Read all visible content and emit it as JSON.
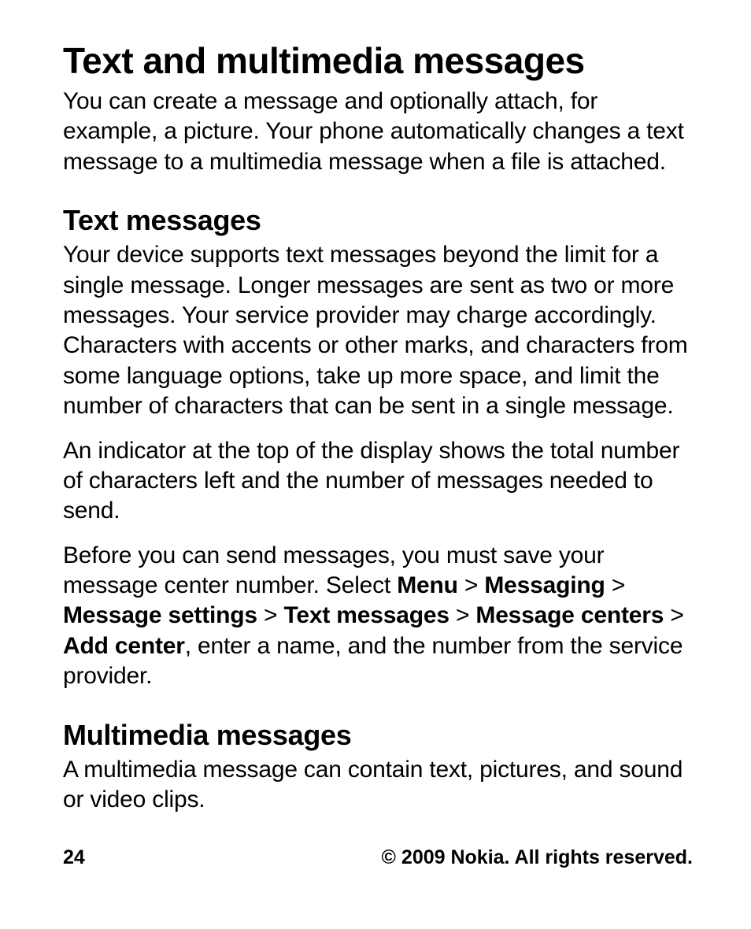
{
  "title": "Text and multimedia messages",
  "intro": "You can create a message and optionally attach, for example, a picture. Your phone automatically changes a text message to a multimedia message when a file is attached.",
  "section_text": {
    "heading": "Text messages",
    "p1": "Your device supports text messages beyond the limit for a single message. Longer messages are sent as two or more messages. Your service provider may charge accordingly. Characters with accents or other marks, and characters from some language options, take up more space, and limit the number of characters that can be sent in a single message.",
    "p2": "An indicator at the top of the display shows the total number of characters left and the number of messages needed to send.",
    "nav_intro": "Before you can send messages, you must save your message center number. Select ",
    "nav_items": [
      "Menu",
      "Messaging",
      "Message settings",
      "Text messages",
      "Message centers",
      "Add center"
    ],
    "nav_sep": " > ",
    "nav_outro": ", enter a name, and the number from the service provider."
  },
  "section_mms": {
    "heading": "Multimedia messages",
    "p1": "A multimedia message can contain text, pictures, and sound or video clips."
  },
  "footer": {
    "page": "24",
    "copyright": "© 2009 Nokia. All rights reserved."
  }
}
